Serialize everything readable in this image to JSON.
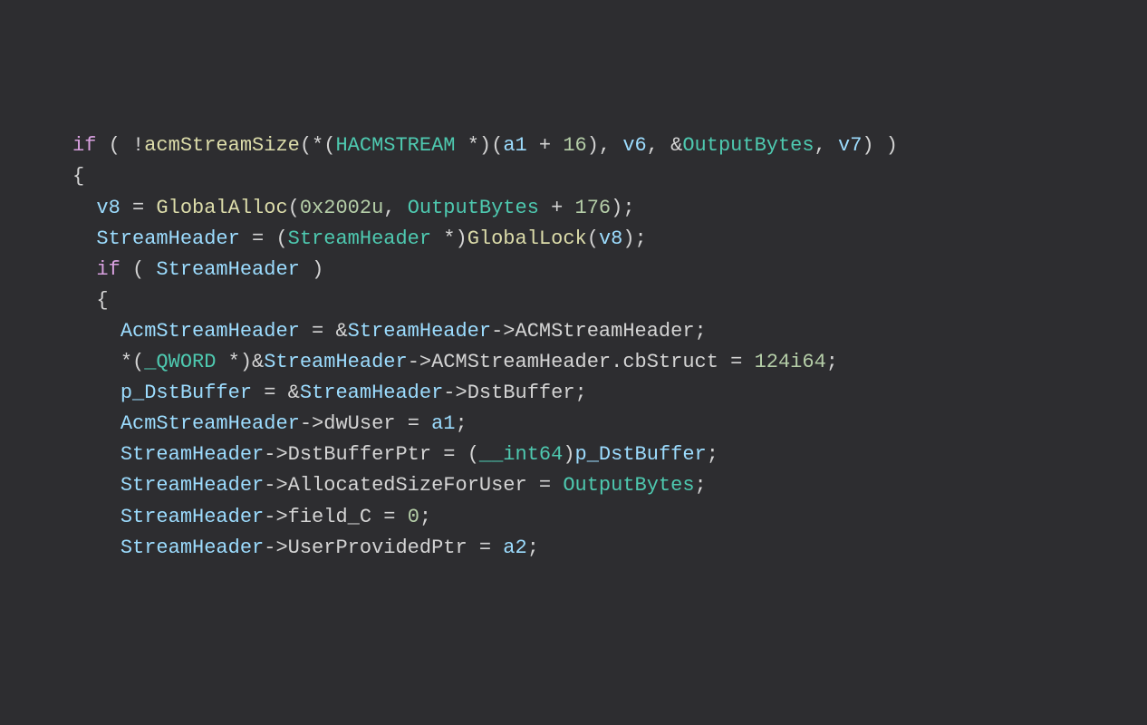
{
  "code": {
    "lines": [
      {
        "indent": 0,
        "tokens": [
          {
            "t": "if ",
            "c": "c-keyword"
          },
          {
            "t": "( !",
            "c": "c-punct"
          },
          {
            "t": "acmStreamSize",
            "c": "c-func"
          },
          {
            "t": "(*(",
            "c": "c-punct"
          },
          {
            "t": "HACMSTREAM ",
            "c": "c-type"
          },
          {
            "t": "*)(",
            "c": "c-punct"
          },
          {
            "t": "a1 ",
            "c": "c-var"
          },
          {
            "t": "+ ",
            "c": "c-op"
          },
          {
            "t": "16",
            "c": "c-num"
          },
          {
            "t": "), ",
            "c": "c-punct"
          },
          {
            "t": "v6",
            "c": "c-var"
          },
          {
            "t": ", &",
            "c": "c-punct"
          },
          {
            "t": "OutputBytes",
            "c": "c-type"
          },
          {
            "t": ", ",
            "c": "c-punct"
          },
          {
            "t": "v7",
            "c": "c-var"
          },
          {
            "t": ") )",
            "c": "c-punct"
          }
        ]
      },
      {
        "indent": 0,
        "tokens": [
          {
            "t": "{",
            "c": "c-brace"
          }
        ]
      },
      {
        "indent": 1,
        "tokens": [
          {
            "t": "v8 ",
            "c": "c-var"
          },
          {
            "t": "= ",
            "c": "c-op"
          },
          {
            "t": "GlobalAlloc",
            "c": "c-func"
          },
          {
            "t": "(",
            "c": "c-punct"
          },
          {
            "t": "0x2002u",
            "c": "c-num"
          },
          {
            "t": ", ",
            "c": "c-punct"
          },
          {
            "t": "OutputBytes ",
            "c": "c-type"
          },
          {
            "t": "+ ",
            "c": "c-op"
          },
          {
            "t": "176",
            "c": "c-num"
          },
          {
            "t": ");",
            "c": "c-punct"
          }
        ]
      },
      {
        "indent": 1,
        "tokens": [
          {
            "t": "StreamHeader ",
            "c": "c-var"
          },
          {
            "t": "= (",
            "c": "c-op"
          },
          {
            "t": "StreamHeader ",
            "c": "c-type"
          },
          {
            "t": "*)",
            "c": "c-punct"
          },
          {
            "t": "GlobalLock",
            "c": "c-func"
          },
          {
            "t": "(",
            "c": "c-punct"
          },
          {
            "t": "v8",
            "c": "c-var"
          },
          {
            "t": ");",
            "c": "c-punct"
          }
        ]
      },
      {
        "indent": 1,
        "tokens": [
          {
            "t": "if ",
            "c": "c-keyword"
          },
          {
            "t": "( ",
            "c": "c-punct"
          },
          {
            "t": "StreamHeader ",
            "c": "c-var"
          },
          {
            "t": ")",
            "c": "c-punct"
          }
        ]
      },
      {
        "indent": 1,
        "tokens": [
          {
            "t": "{",
            "c": "c-brace"
          }
        ]
      },
      {
        "indent": 2,
        "tokens": [
          {
            "t": "AcmStreamHeader ",
            "c": "c-var"
          },
          {
            "t": "= &",
            "c": "c-op"
          },
          {
            "t": "StreamHeader",
            "c": "c-var"
          },
          {
            "t": "->",
            "c": "c-punct"
          },
          {
            "t": "ACMStreamHeader",
            "c": "c-member"
          },
          {
            "t": ";",
            "c": "c-punct"
          }
        ]
      },
      {
        "indent": 2,
        "tokens": [
          {
            "t": "*(",
            "c": "c-punct"
          },
          {
            "t": "_QWORD ",
            "c": "c-type"
          },
          {
            "t": "*)&",
            "c": "c-punct"
          },
          {
            "t": "StreamHeader",
            "c": "c-var"
          },
          {
            "t": "->",
            "c": "c-punct"
          },
          {
            "t": "ACMStreamHeader",
            "c": "c-member"
          },
          {
            "t": ".",
            "c": "c-punct"
          },
          {
            "t": "cbStruct ",
            "c": "c-member"
          },
          {
            "t": "= ",
            "c": "c-op"
          },
          {
            "t": "124i64",
            "c": "c-num"
          },
          {
            "t": ";",
            "c": "c-punct"
          }
        ]
      },
      {
        "indent": 2,
        "tokens": [
          {
            "t": "p_DstBuffer ",
            "c": "c-var"
          },
          {
            "t": "= &",
            "c": "c-op"
          },
          {
            "t": "StreamHeader",
            "c": "c-var"
          },
          {
            "t": "->",
            "c": "c-punct"
          },
          {
            "t": "DstBuffer",
            "c": "c-member"
          },
          {
            "t": ";",
            "c": "c-punct"
          }
        ]
      },
      {
        "indent": 2,
        "tokens": [
          {
            "t": "AcmStreamHeader",
            "c": "c-var"
          },
          {
            "t": "->",
            "c": "c-punct"
          },
          {
            "t": "dwUser ",
            "c": "c-member"
          },
          {
            "t": "= ",
            "c": "c-op"
          },
          {
            "t": "a1",
            "c": "c-var"
          },
          {
            "t": ";",
            "c": "c-punct"
          }
        ]
      },
      {
        "indent": 2,
        "tokens": [
          {
            "t": "StreamHeader",
            "c": "c-var"
          },
          {
            "t": "->",
            "c": "c-punct"
          },
          {
            "t": "DstBufferPtr ",
            "c": "c-member"
          },
          {
            "t": "= (",
            "c": "c-op"
          },
          {
            "t": "__int64",
            "c": "c-type"
          },
          {
            "t": ")",
            "c": "c-punct"
          },
          {
            "t": "p_DstBuffer",
            "c": "c-var"
          },
          {
            "t": ";",
            "c": "c-punct"
          }
        ]
      },
      {
        "indent": 2,
        "tokens": [
          {
            "t": "StreamHeader",
            "c": "c-var"
          },
          {
            "t": "->",
            "c": "c-punct"
          },
          {
            "t": "AllocatedSizeForUser ",
            "c": "c-member"
          },
          {
            "t": "= ",
            "c": "c-op"
          },
          {
            "t": "OutputBytes",
            "c": "c-type"
          },
          {
            "t": ";",
            "c": "c-punct"
          }
        ]
      },
      {
        "indent": 2,
        "tokens": [
          {
            "t": "StreamHeader",
            "c": "c-var"
          },
          {
            "t": "->",
            "c": "c-punct"
          },
          {
            "t": "field_C ",
            "c": "c-member"
          },
          {
            "t": "= ",
            "c": "c-op"
          },
          {
            "t": "0",
            "c": "c-num"
          },
          {
            "t": ";",
            "c": "c-punct"
          }
        ]
      },
      {
        "indent": 2,
        "tokens": [
          {
            "t": "StreamHeader",
            "c": "c-var"
          },
          {
            "t": "->",
            "c": "c-punct"
          },
          {
            "t": "UserProvidedPtr ",
            "c": "c-member"
          },
          {
            "t": "= ",
            "c": "c-op"
          },
          {
            "t": "a2",
            "c": "c-var"
          },
          {
            "t": ";",
            "c": "c-punct"
          }
        ]
      }
    ]
  }
}
